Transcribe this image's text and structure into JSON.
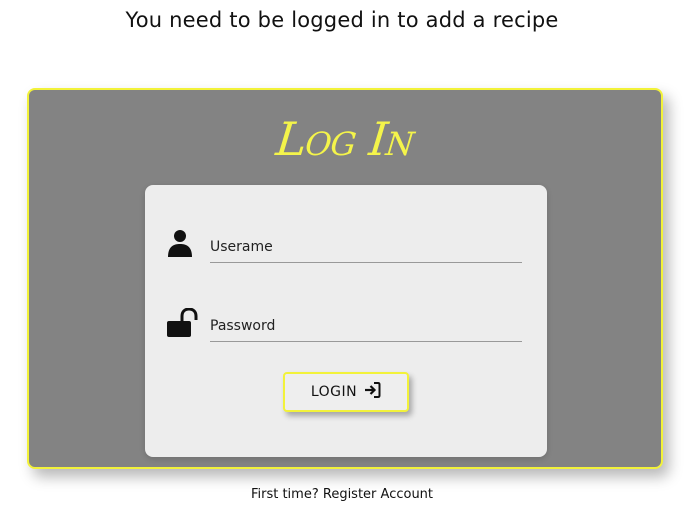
{
  "header": {
    "title": "You need to be logged in to add a recipe"
  },
  "login": {
    "heading": "Log In",
    "username": {
      "placeholder": "Userame",
      "icon": "user-icon"
    },
    "password": {
      "placeholder": "Password",
      "icon": "unlock-icon"
    },
    "button": {
      "label": "LOGIN",
      "icon": "sign-in-icon"
    }
  },
  "footer": {
    "prompt": "First time?",
    "register_label": "Register Account"
  },
  "colors": {
    "accent": "#f2f23a",
    "panel": "#838383",
    "card": "#ededed"
  }
}
